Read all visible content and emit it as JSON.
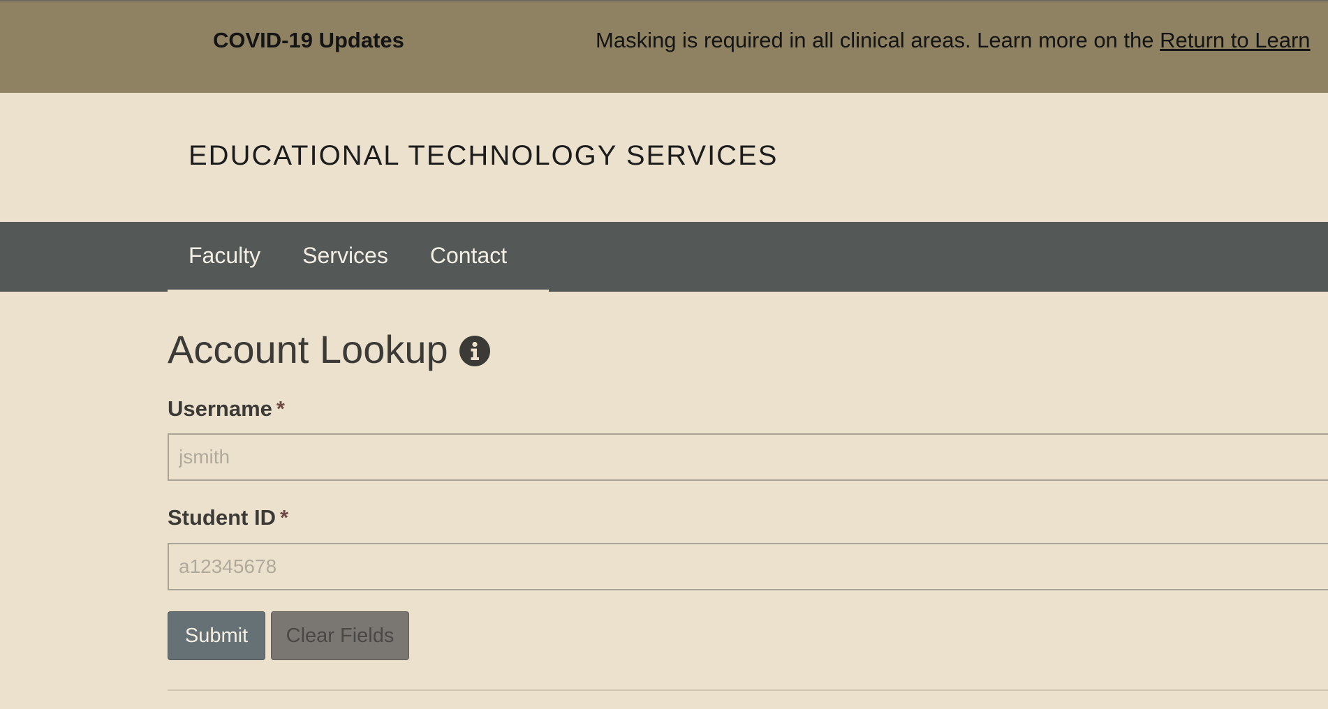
{
  "alert": {
    "title": "COVID-19 Updates",
    "message": "Masking is required in all clinical areas. Learn more on the ",
    "link_text": "Return to Learn"
  },
  "header": {
    "site_title": "EDUCATIONAL TECHNOLOGY SERVICES"
  },
  "nav": {
    "items": [
      {
        "label": "Faculty"
      },
      {
        "label": "Services"
      },
      {
        "label": "Contact"
      }
    ]
  },
  "form": {
    "title": "Account Lookup",
    "info_icon": "info-icon",
    "required_marker": "*",
    "username": {
      "label": "Username",
      "placeholder": "jsmith",
      "value": ""
    },
    "student_id": {
      "label": "Student ID",
      "placeholder": "a12345678",
      "value": ""
    },
    "submit_label": "Submit",
    "clear_label": "Clear Fields"
  },
  "colors": {
    "alert_bg": "#8f8263",
    "page_bg": "#ebe1cd",
    "nav_bg": "#545958",
    "submit_bg": "#657175",
    "clear_bg": "#7a7773"
  }
}
